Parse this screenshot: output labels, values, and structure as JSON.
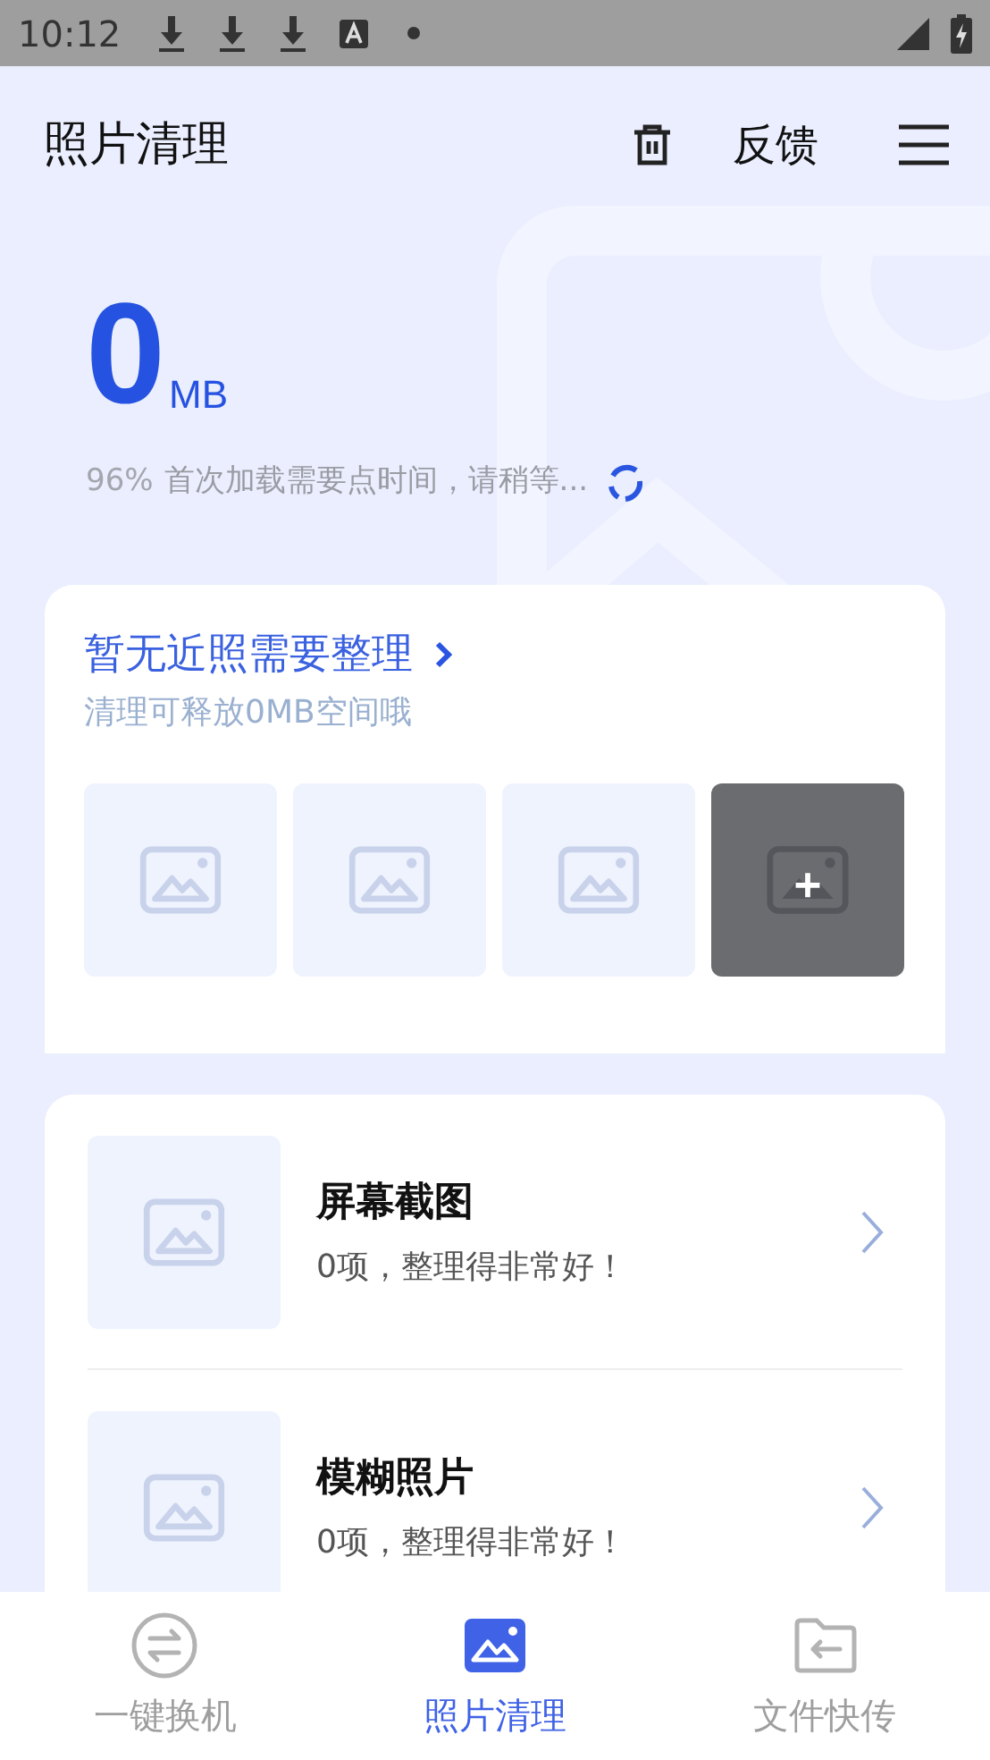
{
  "status_bar": {
    "time": "10:12"
  },
  "header": {
    "title": "照片清理",
    "feedback": "反馈"
  },
  "summary": {
    "value": "0",
    "unit": "MB",
    "percent": "96%",
    "message": "首次加载需要点时间，请稍等..."
  },
  "recent": {
    "title": "暂无近照需要整理",
    "subtitle": "清理可释放0MB空间哦",
    "thumbnails": [
      {
        "kind": "empty"
      },
      {
        "kind": "empty"
      },
      {
        "kind": "empty"
      },
      {
        "kind": "add"
      }
    ]
  },
  "categories": [
    {
      "title": "屏幕截图",
      "status": "0项，整理得非常好！"
    },
    {
      "title": "模糊照片",
      "status": "0项，整理得非常好！"
    }
  ],
  "tabs": [
    {
      "label": "一键换机",
      "kind": "swap",
      "selected": false
    },
    {
      "label": "照片清理",
      "kind": "photo",
      "selected": true
    },
    {
      "label": "文件快传",
      "kind": "folder",
      "selected": false
    }
  ]
}
